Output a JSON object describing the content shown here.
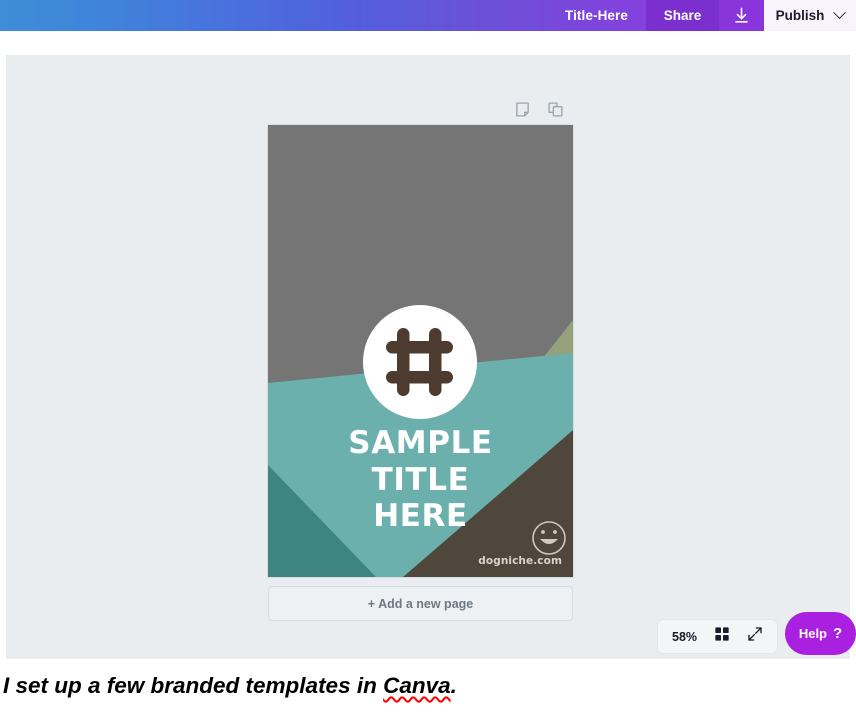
{
  "topbar": {
    "title": "Title-Here",
    "share_label": "Share",
    "download_icon": "download-icon",
    "publish_label": "Publish",
    "chevron_icon": "chevron-down-icon",
    "gradient_from": "#3d8ed6",
    "gradient_to": "#8e3ee2"
  },
  "editor": {
    "background": "#eaedf0",
    "page_tools": [
      {
        "name": "notes-icon",
        "label": "Notes"
      },
      {
        "name": "duplicate-page-icon",
        "label": "Duplicate page"
      }
    ],
    "add_page_label": "+ Add a new page",
    "zoom_level": "58%",
    "grid_icon": "grid-view-icon",
    "expand_icon": "expand-icon",
    "help_label": "Help",
    "help_mark": "?",
    "help_color": "#a920e0"
  },
  "design": {
    "title_line1": "SAMPLE",
    "title_line2": "TITLE",
    "title_line3": "HERE",
    "brand_url": "dogniche.com",
    "logo_icon": "hashtag-icon",
    "smiley_icon": "smiley-face-icon",
    "colors": {
      "gray": "#757575",
      "teal": "#6cb0ae",
      "dark_teal": "#3e8582",
      "olive": "#96a07b",
      "brown": "#4f463c",
      "logo_brown": "#4e3b30",
      "white": "#ffffff"
    }
  },
  "caption": {
    "text_before": "I set up a few branded templates in ",
    "misspelled_word": "Canva",
    "text_after": "."
  }
}
